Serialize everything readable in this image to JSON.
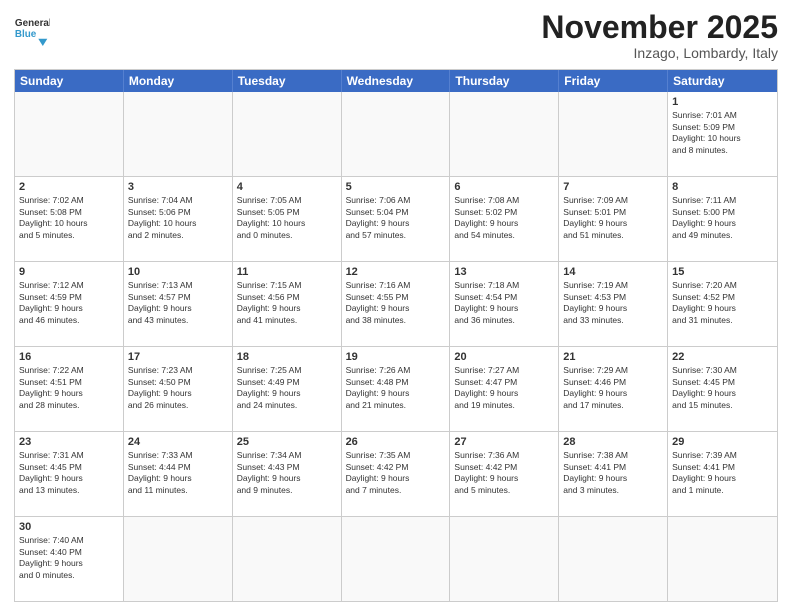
{
  "header": {
    "logo_general": "General",
    "logo_blue": "Blue",
    "month_title": "November 2025",
    "location": "Inzago, Lombardy, Italy"
  },
  "days_of_week": [
    "Sunday",
    "Monday",
    "Tuesday",
    "Wednesday",
    "Thursday",
    "Friday",
    "Saturday"
  ],
  "weeks": [
    [
      {
        "day": "",
        "info": ""
      },
      {
        "day": "",
        "info": ""
      },
      {
        "day": "",
        "info": ""
      },
      {
        "day": "",
        "info": ""
      },
      {
        "day": "",
        "info": ""
      },
      {
        "day": "",
        "info": ""
      },
      {
        "day": "1",
        "info": "Sunrise: 7:01 AM\nSunset: 5:09 PM\nDaylight: 10 hours\nand 8 minutes."
      }
    ],
    [
      {
        "day": "2",
        "info": "Sunrise: 7:02 AM\nSunset: 5:08 PM\nDaylight: 10 hours\nand 5 minutes."
      },
      {
        "day": "3",
        "info": "Sunrise: 7:04 AM\nSunset: 5:06 PM\nDaylight: 10 hours\nand 2 minutes."
      },
      {
        "day": "4",
        "info": "Sunrise: 7:05 AM\nSunset: 5:05 PM\nDaylight: 10 hours\nand 0 minutes."
      },
      {
        "day": "5",
        "info": "Sunrise: 7:06 AM\nSunset: 5:04 PM\nDaylight: 9 hours\nand 57 minutes."
      },
      {
        "day": "6",
        "info": "Sunrise: 7:08 AM\nSunset: 5:02 PM\nDaylight: 9 hours\nand 54 minutes."
      },
      {
        "day": "7",
        "info": "Sunrise: 7:09 AM\nSunset: 5:01 PM\nDaylight: 9 hours\nand 51 minutes."
      },
      {
        "day": "8",
        "info": "Sunrise: 7:11 AM\nSunset: 5:00 PM\nDaylight: 9 hours\nand 49 minutes."
      }
    ],
    [
      {
        "day": "9",
        "info": "Sunrise: 7:12 AM\nSunset: 4:59 PM\nDaylight: 9 hours\nand 46 minutes."
      },
      {
        "day": "10",
        "info": "Sunrise: 7:13 AM\nSunset: 4:57 PM\nDaylight: 9 hours\nand 43 minutes."
      },
      {
        "day": "11",
        "info": "Sunrise: 7:15 AM\nSunset: 4:56 PM\nDaylight: 9 hours\nand 41 minutes."
      },
      {
        "day": "12",
        "info": "Sunrise: 7:16 AM\nSunset: 4:55 PM\nDaylight: 9 hours\nand 38 minutes."
      },
      {
        "day": "13",
        "info": "Sunrise: 7:18 AM\nSunset: 4:54 PM\nDaylight: 9 hours\nand 36 minutes."
      },
      {
        "day": "14",
        "info": "Sunrise: 7:19 AM\nSunset: 4:53 PM\nDaylight: 9 hours\nand 33 minutes."
      },
      {
        "day": "15",
        "info": "Sunrise: 7:20 AM\nSunset: 4:52 PM\nDaylight: 9 hours\nand 31 minutes."
      }
    ],
    [
      {
        "day": "16",
        "info": "Sunrise: 7:22 AM\nSunset: 4:51 PM\nDaylight: 9 hours\nand 28 minutes."
      },
      {
        "day": "17",
        "info": "Sunrise: 7:23 AM\nSunset: 4:50 PM\nDaylight: 9 hours\nand 26 minutes."
      },
      {
        "day": "18",
        "info": "Sunrise: 7:25 AM\nSunset: 4:49 PM\nDaylight: 9 hours\nand 24 minutes."
      },
      {
        "day": "19",
        "info": "Sunrise: 7:26 AM\nSunset: 4:48 PM\nDaylight: 9 hours\nand 21 minutes."
      },
      {
        "day": "20",
        "info": "Sunrise: 7:27 AM\nSunset: 4:47 PM\nDaylight: 9 hours\nand 19 minutes."
      },
      {
        "day": "21",
        "info": "Sunrise: 7:29 AM\nSunset: 4:46 PM\nDaylight: 9 hours\nand 17 minutes."
      },
      {
        "day": "22",
        "info": "Sunrise: 7:30 AM\nSunset: 4:45 PM\nDaylight: 9 hours\nand 15 minutes."
      }
    ],
    [
      {
        "day": "23",
        "info": "Sunrise: 7:31 AM\nSunset: 4:45 PM\nDaylight: 9 hours\nand 13 minutes."
      },
      {
        "day": "24",
        "info": "Sunrise: 7:33 AM\nSunset: 4:44 PM\nDaylight: 9 hours\nand 11 minutes."
      },
      {
        "day": "25",
        "info": "Sunrise: 7:34 AM\nSunset: 4:43 PM\nDaylight: 9 hours\nand 9 minutes."
      },
      {
        "day": "26",
        "info": "Sunrise: 7:35 AM\nSunset: 4:42 PM\nDaylight: 9 hours\nand 7 minutes."
      },
      {
        "day": "27",
        "info": "Sunrise: 7:36 AM\nSunset: 4:42 PM\nDaylight: 9 hours\nand 5 minutes."
      },
      {
        "day": "28",
        "info": "Sunrise: 7:38 AM\nSunset: 4:41 PM\nDaylight: 9 hours\nand 3 minutes."
      },
      {
        "day": "29",
        "info": "Sunrise: 7:39 AM\nSunset: 4:41 PM\nDaylight: 9 hours\nand 1 minute."
      }
    ],
    [
      {
        "day": "30",
        "info": "Sunrise: 7:40 AM\nSunset: 4:40 PM\nDaylight: 9 hours\nand 0 minutes."
      },
      {
        "day": "",
        "info": ""
      },
      {
        "day": "",
        "info": ""
      },
      {
        "day": "",
        "info": ""
      },
      {
        "day": "",
        "info": ""
      },
      {
        "day": "",
        "info": ""
      },
      {
        "day": "",
        "info": ""
      }
    ]
  ]
}
